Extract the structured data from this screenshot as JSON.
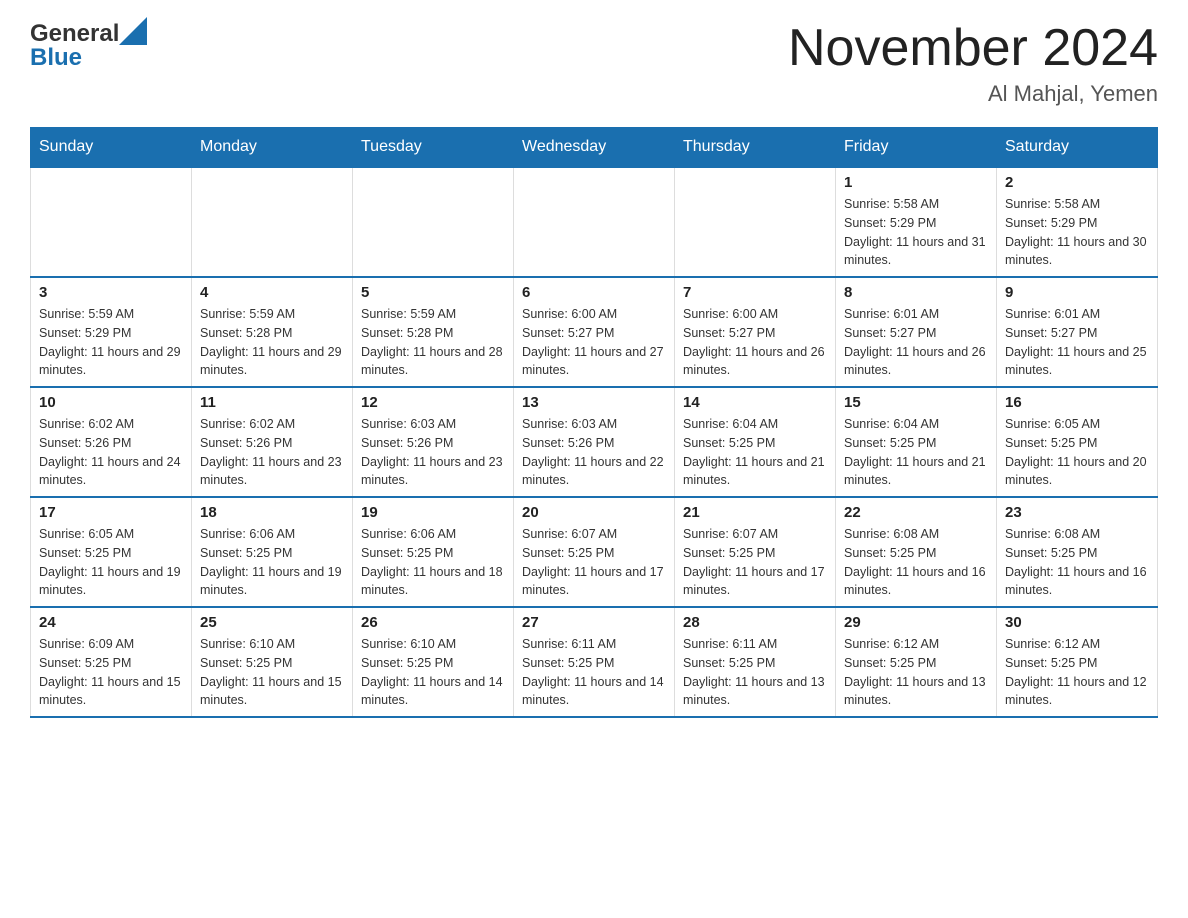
{
  "header": {
    "logo_general": "General",
    "logo_blue": "Blue",
    "main_title": "November 2024",
    "subtitle": "Al Mahjal, Yemen"
  },
  "calendar": {
    "days_of_week": [
      "Sunday",
      "Monday",
      "Tuesday",
      "Wednesday",
      "Thursday",
      "Friday",
      "Saturday"
    ],
    "weeks": [
      [
        {
          "day": "",
          "info": ""
        },
        {
          "day": "",
          "info": ""
        },
        {
          "day": "",
          "info": ""
        },
        {
          "day": "",
          "info": ""
        },
        {
          "day": "",
          "info": ""
        },
        {
          "day": "1",
          "info": "Sunrise: 5:58 AM\nSunset: 5:29 PM\nDaylight: 11 hours and 31 minutes."
        },
        {
          "day": "2",
          "info": "Sunrise: 5:58 AM\nSunset: 5:29 PM\nDaylight: 11 hours and 30 minutes."
        }
      ],
      [
        {
          "day": "3",
          "info": "Sunrise: 5:59 AM\nSunset: 5:29 PM\nDaylight: 11 hours and 29 minutes."
        },
        {
          "day": "4",
          "info": "Sunrise: 5:59 AM\nSunset: 5:28 PM\nDaylight: 11 hours and 29 minutes."
        },
        {
          "day": "5",
          "info": "Sunrise: 5:59 AM\nSunset: 5:28 PM\nDaylight: 11 hours and 28 minutes."
        },
        {
          "day": "6",
          "info": "Sunrise: 6:00 AM\nSunset: 5:27 PM\nDaylight: 11 hours and 27 minutes."
        },
        {
          "day": "7",
          "info": "Sunrise: 6:00 AM\nSunset: 5:27 PM\nDaylight: 11 hours and 26 minutes."
        },
        {
          "day": "8",
          "info": "Sunrise: 6:01 AM\nSunset: 5:27 PM\nDaylight: 11 hours and 26 minutes."
        },
        {
          "day": "9",
          "info": "Sunrise: 6:01 AM\nSunset: 5:27 PM\nDaylight: 11 hours and 25 minutes."
        }
      ],
      [
        {
          "day": "10",
          "info": "Sunrise: 6:02 AM\nSunset: 5:26 PM\nDaylight: 11 hours and 24 minutes."
        },
        {
          "day": "11",
          "info": "Sunrise: 6:02 AM\nSunset: 5:26 PM\nDaylight: 11 hours and 23 minutes."
        },
        {
          "day": "12",
          "info": "Sunrise: 6:03 AM\nSunset: 5:26 PM\nDaylight: 11 hours and 23 minutes."
        },
        {
          "day": "13",
          "info": "Sunrise: 6:03 AM\nSunset: 5:26 PM\nDaylight: 11 hours and 22 minutes."
        },
        {
          "day": "14",
          "info": "Sunrise: 6:04 AM\nSunset: 5:25 PM\nDaylight: 11 hours and 21 minutes."
        },
        {
          "day": "15",
          "info": "Sunrise: 6:04 AM\nSunset: 5:25 PM\nDaylight: 11 hours and 21 minutes."
        },
        {
          "day": "16",
          "info": "Sunrise: 6:05 AM\nSunset: 5:25 PM\nDaylight: 11 hours and 20 minutes."
        }
      ],
      [
        {
          "day": "17",
          "info": "Sunrise: 6:05 AM\nSunset: 5:25 PM\nDaylight: 11 hours and 19 minutes."
        },
        {
          "day": "18",
          "info": "Sunrise: 6:06 AM\nSunset: 5:25 PM\nDaylight: 11 hours and 19 minutes."
        },
        {
          "day": "19",
          "info": "Sunrise: 6:06 AM\nSunset: 5:25 PM\nDaylight: 11 hours and 18 minutes."
        },
        {
          "day": "20",
          "info": "Sunrise: 6:07 AM\nSunset: 5:25 PM\nDaylight: 11 hours and 17 minutes."
        },
        {
          "day": "21",
          "info": "Sunrise: 6:07 AM\nSunset: 5:25 PM\nDaylight: 11 hours and 17 minutes."
        },
        {
          "day": "22",
          "info": "Sunrise: 6:08 AM\nSunset: 5:25 PM\nDaylight: 11 hours and 16 minutes."
        },
        {
          "day": "23",
          "info": "Sunrise: 6:08 AM\nSunset: 5:25 PM\nDaylight: 11 hours and 16 minutes."
        }
      ],
      [
        {
          "day": "24",
          "info": "Sunrise: 6:09 AM\nSunset: 5:25 PM\nDaylight: 11 hours and 15 minutes."
        },
        {
          "day": "25",
          "info": "Sunrise: 6:10 AM\nSunset: 5:25 PM\nDaylight: 11 hours and 15 minutes."
        },
        {
          "day": "26",
          "info": "Sunrise: 6:10 AM\nSunset: 5:25 PM\nDaylight: 11 hours and 14 minutes."
        },
        {
          "day": "27",
          "info": "Sunrise: 6:11 AM\nSunset: 5:25 PM\nDaylight: 11 hours and 14 minutes."
        },
        {
          "day": "28",
          "info": "Sunrise: 6:11 AM\nSunset: 5:25 PM\nDaylight: 11 hours and 13 minutes."
        },
        {
          "day": "29",
          "info": "Sunrise: 6:12 AM\nSunset: 5:25 PM\nDaylight: 11 hours and 13 minutes."
        },
        {
          "day": "30",
          "info": "Sunrise: 6:12 AM\nSunset: 5:25 PM\nDaylight: 11 hours and 12 minutes."
        }
      ]
    ]
  }
}
